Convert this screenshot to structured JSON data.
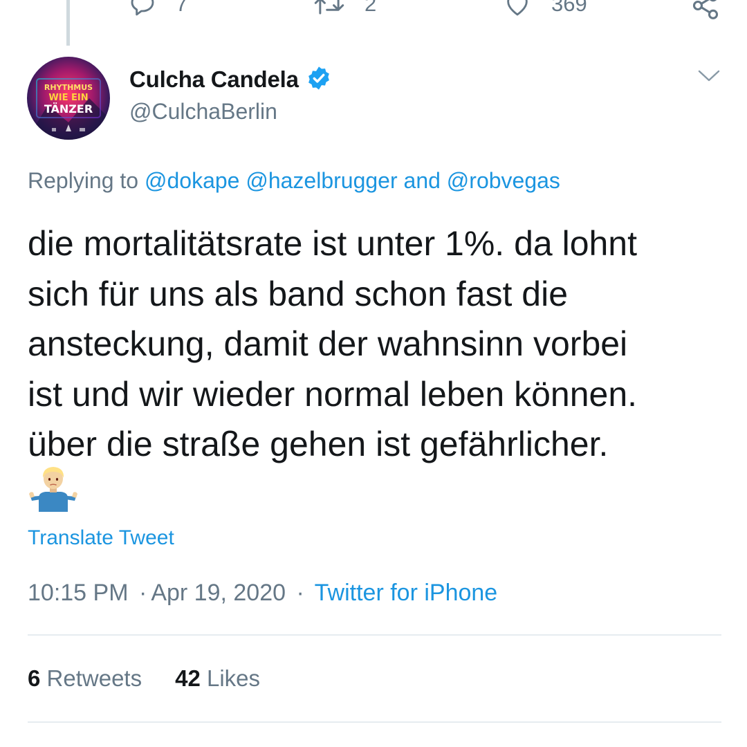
{
  "previous_tweet_actions": {
    "reply_count": "7",
    "retweet_count": "2",
    "like_count": "369"
  },
  "author": {
    "display_name": "Culcha Candela",
    "handle": "@CulchaBerlin",
    "verified": true,
    "avatar_text": [
      "RHYTHMUS",
      "WIE EIN",
      "TÄNZER"
    ]
  },
  "replying": {
    "prefix": "Replying to",
    "mention_1": "@dokape",
    "mention_2": "@hazelbrugger",
    "conjunction": "and",
    "mention_3": "@robvegas"
  },
  "tweet": {
    "lines": [
      "die mortalitätsrate ist unter 1%. da lohnt",
      "sich für uns als band schon fast die",
      "ansteckung, damit der wahnsinn vorbei",
      "ist und wir wieder normal leben können.",
      "über die straße gehen ist gefährlicher."
    ],
    "emoji": "person-shrugging"
  },
  "translate_label": "Translate Tweet",
  "meta": {
    "time": "10:15 PM",
    "separator": "·",
    "date": "Apr 19, 2020",
    "source": "Twitter for iPhone"
  },
  "stats": {
    "retweets_count": "6",
    "retweets_label": "Retweets",
    "likes_count": "42",
    "likes_label": "Likes"
  },
  "colors": {
    "link_blue": "#1b95e0",
    "secondary_text": "#657786",
    "primary_text": "#14171a",
    "divider": "#e6ecf0"
  }
}
